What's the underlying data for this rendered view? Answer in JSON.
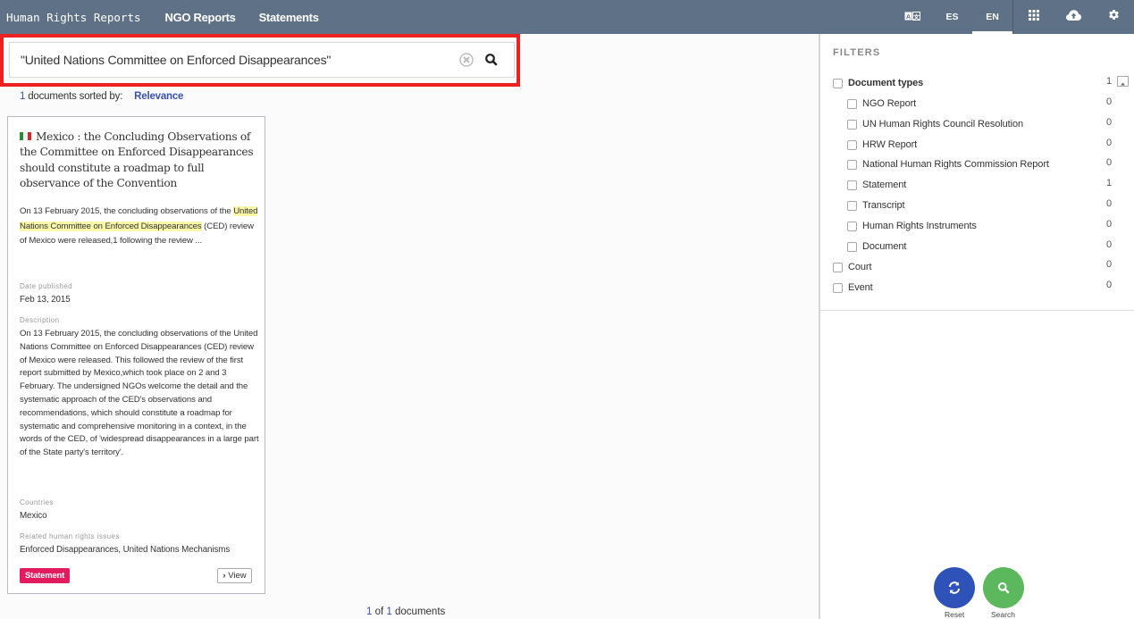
{
  "topnav": {
    "brand": "Human Rights Reports",
    "links": [
      "NGO Reports",
      "Statements"
    ],
    "languages": {
      "translate_icon": "translate-icon",
      "es": "ES",
      "en": "EN",
      "active": "EN"
    },
    "icons": [
      "apps-grid-icon",
      "cloud-upload-icon",
      "gear-icon"
    ],
    "bg_color": "#5f7187"
  },
  "search": {
    "value": "\"United Nations Committee on Enforced Disappearances\"",
    "clear_icon": "clear-circle-icon",
    "search_icon": "search-icon",
    "highlight_color": "#ee2020"
  },
  "results": {
    "count": "1",
    "sorted_label": "documents sorted by:",
    "sort_value": "Relevance"
  },
  "card": {
    "flag": "mexico-flag-icon",
    "title": "Mexico : the Concluding Observations of the Committee on Enforced Disappearances should constitute a roadmap to full observance of the Convention",
    "snippet_before": "On 13 February 2015, the concluding observations of the ",
    "snippet_highlight": "United Nations Committee on Enforced Disappearances",
    "snippet_after": " (CED) review of Mexico were released,1 following the review ...",
    "date_label": "Date published",
    "date_value": "Feb 13, 2015",
    "description_label": "Description",
    "description": "On 13 February 2015, the concluding observations of the United Nations Committee on Enforced Disappearances (CED) review of Mexico were released. This followed the review of the first report submitted by Mexico,which took place on 2 and 3 February. The undersigned NGOs welcome the detail and the systematic approach of the CED's observations and recommendations, which should constitute a roadmap for systematic and comprehensive monitoring in a context, in the words of the CED, of 'widespread disappearances in a large part of the State party's territory'.",
    "countries_label": "Countries",
    "countries_value": "Mexico",
    "issues_label": "Related human rights issues",
    "issues_value": "Enforced Disappearances, United Nations Mechanisms",
    "tag": "Statement",
    "tag_color": "#e31b5f",
    "view_label": "View"
  },
  "pager": {
    "current": "1",
    "of": "of",
    "total": "1",
    "suffix": "documents"
  },
  "filters": {
    "title": "FILTERS",
    "groups": [
      {
        "label": "Document types",
        "count": "1",
        "expanded": true,
        "children": [
          {
            "label": "NGO Report",
            "count": "0"
          },
          {
            "label": "UN Human Rights Council Resolution",
            "count": "0"
          },
          {
            "label": "HRW Report",
            "count": "0"
          },
          {
            "label": "National Human Rights Commission Report",
            "count": "0"
          },
          {
            "label": "Statement",
            "count": "1"
          },
          {
            "label": "Transcript",
            "count": "0"
          },
          {
            "label": "Human Rights Instruments",
            "count": "0"
          },
          {
            "label": "Document",
            "count": "0"
          }
        ]
      },
      {
        "label": "Court",
        "count": "0"
      },
      {
        "label": "Event",
        "count": "0"
      }
    ]
  },
  "actions": {
    "reset_label": "Reset",
    "search_label": "Search",
    "reset_color": "#2f52b8",
    "search_color": "#5cb85c"
  }
}
